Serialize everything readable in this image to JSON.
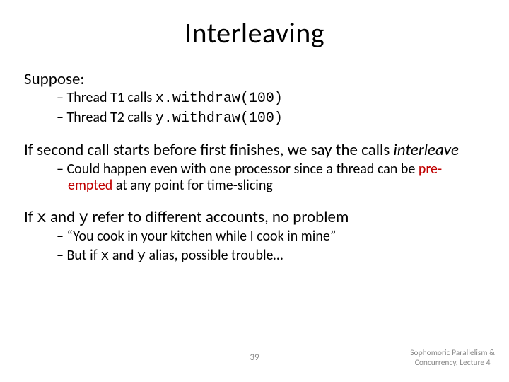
{
  "title": "Interleaving",
  "block1": {
    "lead": "Suppose:",
    "items": [
      {
        "pre": "Thread T1 calls ",
        "code": "x.withdraw(100)"
      },
      {
        "pre": "Thread T2 calls ",
        "code": "y.withdraw(100)"
      }
    ]
  },
  "block2": {
    "lead_pre": "If second call starts before first finishes, we say the calls ",
    "lead_em": "interleave",
    "items": [
      {
        "a": "Could happen even with one processor since a thread can be ",
        "red": "pre-empted",
        "b": " at any point for time-slicing"
      }
    ]
  },
  "block3": {
    "lead_a": "If ",
    "lead_x": "x",
    "lead_b": " and ",
    "lead_y": "y",
    "lead_c": " refer to different accounts, no problem",
    "items": [
      {
        "plain": "“You cook in your kitchen while I cook in mine”"
      },
      {
        "a": "But if ",
        "x": "x",
        "b": " and ",
        "y": "y",
        "c": " alias, possible trouble…"
      }
    ]
  },
  "footer": {
    "page": "39",
    "credit_l1": "Sophomoric Parallelism &",
    "credit_l2": "Concurrency, Lecture 4"
  }
}
